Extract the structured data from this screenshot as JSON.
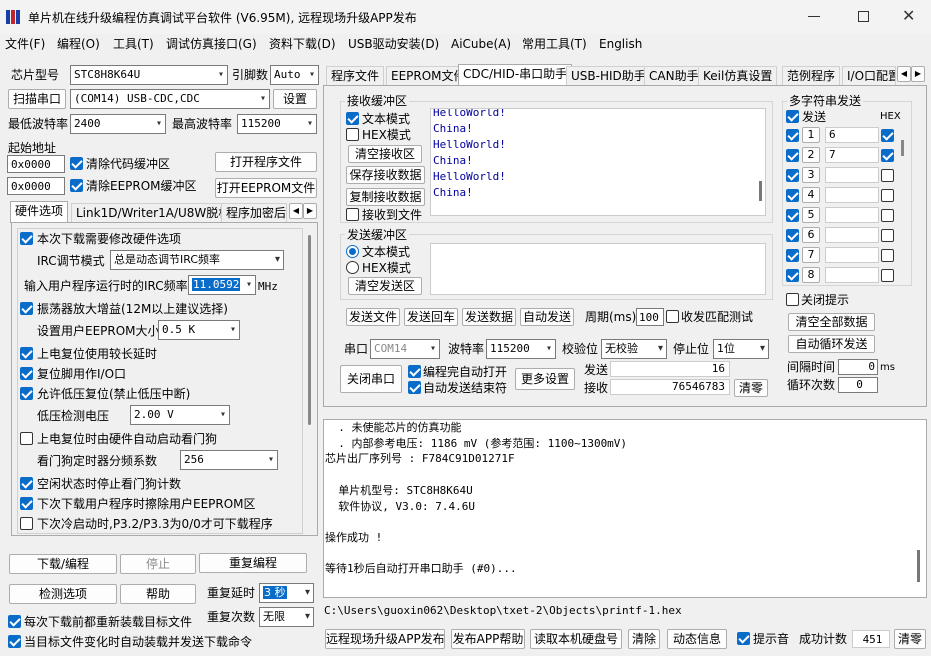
{
  "title": "单片机在线升级编程仿真调试平台软件 (V6.95M), 远程现场升级APP发布",
  "menu": [
    "文件(F)",
    "编程(O)",
    "工具(T)",
    "调试仿真接口(G)",
    "资料下载(D)",
    "USB驱动安装(D)",
    "AiCube(A)",
    "常用工具(T)",
    "English"
  ],
  "left": {
    "chip_label": "芯片型号",
    "chip_value": "STC8H8K64U",
    "pin_label": "引脚数",
    "pin_value": "Auto",
    "scan_btn": "扫描串口",
    "port_value": "(COM14) USB-CDC,CDC",
    "settings_btn": "设置",
    "min_baud_label": "最低波特率",
    "min_baud": "2400",
    "max_baud_label": "最高波特率",
    "max_baud": "115200",
    "start_addr_label": "起始地址",
    "addr1": "0x0000",
    "clear_code": "清除代码缓冲区",
    "open_prog": "打开程序文件",
    "addr2": "0x0000",
    "clear_eeprom": "清除EEPROM缓冲区",
    "open_eeprom": "打开EEPROM文件",
    "tabs": [
      "硬件选项",
      "Link1D/Writer1A/U8W脱机",
      "程序加密后"
    ],
    "hw": {
      "opt1": "本次下载需要修改硬件选项",
      "irc_mode_label": "IRC调节模式",
      "irc_mode": "总是动态调节IRC频率",
      "freq_label": "输入用户程序运行时的IRC频率",
      "freq": "11.0592",
      "freq_unit": "MHz",
      "opt2": "振荡器放大增益(12M以上建议选择)",
      "eeprom_label": "设置用户EEPROM大小",
      "eeprom": "0.5 K",
      "opt3": "上电复位使用较长延时",
      "opt4": "复位脚用作I/O口",
      "opt5": "允许低压复位(禁止低压中断)",
      "lv_label": "低压检测电压",
      "lv": "2.00 V",
      "opt6": "上电复位时由硬件自动启动看门狗",
      "wdt_label": "看门狗定时器分频系数",
      "wdt": "256",
      "opt7": "空闲状态时停止看门狗计数",
      "opt8": "下次下载用户程序时擦除用户EEPROM区",
      "opt9": "下次冷启动时,P3.2/P3.3为0/0才可下载程序"
    },
    "download_btn": "下载/编程",
    "stop_btn": "停止",
    "reprogram_btn": "重复编程",
    "check_btn": "检测选项",
    "help_btn": "帮助",
    "repeat_delay_label": "重复延时",
    "repeat_delay": "3 秒",
    "repeat_count_label": "重复次数",
    "repeat_count": "无限",
    "reload_label": "每次下载前都重新装载目标文件",
    "auto_send_label": "当目标文件变化时自动装载并发送下载命令"
  },
  "right": {
    "tabs": [
      "程序文件",
      "EEPROM文件",
      "CDC/HID-串口助手",
      "USB-HID助手",
      "CAN助手",
      "Keil仿真设置",
      "范例程序",
      "I/O口配置"
    ],
    "recv_group": "接收缓冲区",
    "text_mode": "文本模式",
    "hex_mode": "HEX模式",
    "clear_recv": "清空接收区",
    "save_recv": "保存接收数据",
    "copy_recv": "复制接收数据",
    "recv_to_file": "接收到文件",
    "recv_lines": [
      "HelloWorld!",
      "China!",
      "HelloWorld!",
      "China!",
      "HelloWorld!",
      "China!"
    ],
    "send_group": "发送缓冲区",
    "send_text_mode": "文本模式",
    "send_hex_mode": "HEX模式",
    "clear_send": "清空发送区",
    "send_file": "发送文件",
    "send_return": "发送回车",
    "send_data": "发送数据",
    "auto_send": "自动发送",
    "period_label": "周期(ms)",
    "period": "100",
    "match_label": "收发匹配测试",
    "multi_group": "多字符串发送",
    "send_hdr": "发送",
    "hex_hdr": "HEX",
    "multi_rows": [
      {
        "n": "1",
        "v": "6",
        "hex": true
      },
      {
        "n": "2",
        "v": "7",
        "hex": true
      },
      {
        "n": "3",
        "v": "",
        "hex": false
      },
      {
        "n": "4",
        "v": "",
        "hex": false
      },
      {
        "n": "5",
        "v": "",
        "hex": false
      },
      {
        "n": "6",
        "v": "",
        "hex": false
      },
      {
        "n": "7",
        "v": "",
        "hex": false
      },
      {
        "n": "8",
        "v": "",
        "hex": false
      }
    ],
    "close_hint": "关闭提示",
    "clear_all": "清空全部数据",
    "auto_loop": "自动循环发送",
    "interval_label": "间隔时间",
    "interval": "0",
    "interval_unit": "ms",
    "loop_label": "循环次数",
    "loop": "0",
    "port_label": "串口",
    "port": "COM14",
    "baud_label": "波特率",
    "baud": "115200",
    "parity_label": "校验位",
    "parity": "无校验",
    "stop_label": "停止位",
    "stopbits": "1位",
    "close_port": "关闭串口",
    "auto_open": "编程完自动打开",
    "auto_send_end": "自动发送结束符",
    "more": "更多设置",
    "sent_label": "发送",
    "sent": "16",
    "recv_label": "接收",
    "recv": "76546783",
    "clear_counts": "清零"
  },
  "log": {
    "lines": [
      "  . 未使能芯片的仿真功能",
      "  . 内部参考电压: 1186 mV (参考范围: 1100~1300mV)",
      "芯片出厂序列号 : F784C91D01271F",
      "",
      "  单片机型号: STC8H8K64U",
      "  软件协议, V3.0: 7.4.6U",
      "",
      "操作成功 !",
      "",
      "等待1秒后自动打开串口助手 (#0)..."
    ],
    "path": "C:\\Users\\guoxin062\\Desktop\\txet-2\\Objects\\printf-1.hex"
  },
  "bottom": {
    "publish": "远程现场升级APP发布",
    "publish_help": "发布APP帮助",
    "read_disk": "读取本机硬盘号",
    "clear": "清除",
    "anim": "动态信息",
    "beep": "提示音",
    "success_label": "成功计数",
    "success": "451",
    "clear_zero": "清零"
  }
}
